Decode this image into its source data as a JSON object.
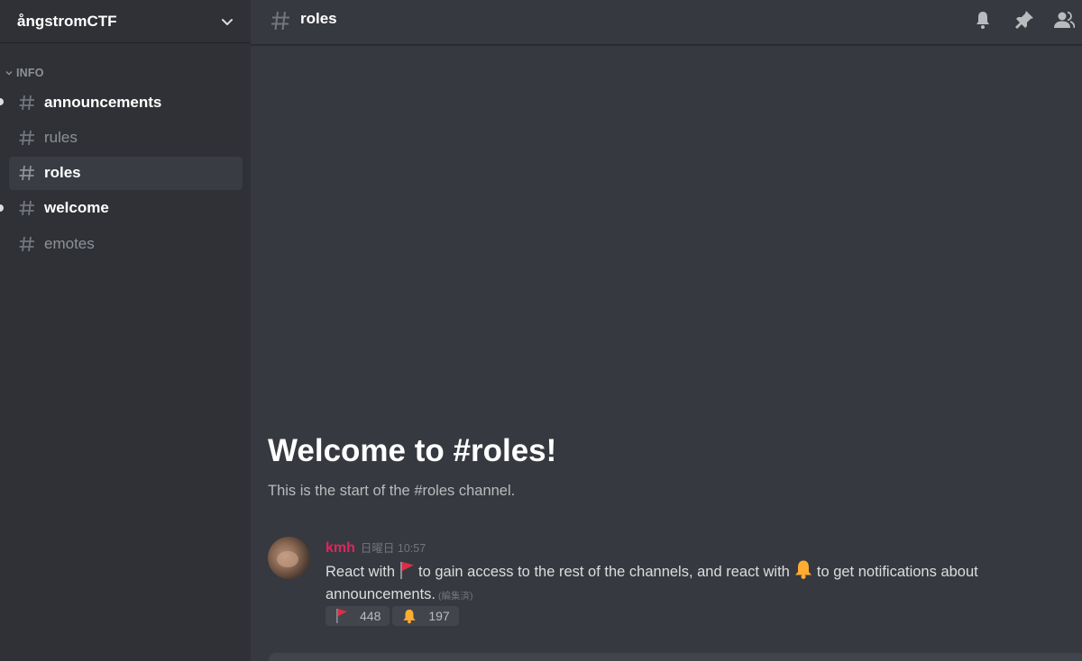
{
  "server": {
    "name": "ångstromCTF"
  },
  "sidebar": {
    "category": "INFO",
    "channels": [
      {
        "name": "announcements",
        "state": "unread"
      },
      {
        "name": "rules",
        "state": "muted"
      },
      {
        "name": "roles",
        "state": "selected"
      },
      {
        "name": "welcome",
        "state": "unread"
      },
      {
        "name": "emotes",
        "state": "muted"
      }
    ]
  },
  "topbar": {
    "channel_name": "roles",
    "icons": [
      "bell-icon",
      "pin-icon",
      "members-icon"
    ]
  },
  "main": {
    "welcome_title": "Welcome to #roles!",
    "welcome_subtitle": "This is the start of the #roles channel."
  },
  "message": {
    "author": "kmh",
    "author_color": "#e0245e",
    "timestamp": "日曜日 10:57",
    "text_part1": "React with",
    "text_part2": "to gain access to the rest of the channels, and react with",
    "text_part3": "to get notifications about announcements.",
    "edited_label": "(編集済)",
    "reactions": [
      {
        "emoji": "red-flag-icon",
        "count": "448"
      },
      {
        "emoji": "bell-emoji-icon",
        "count": "197"
      }
    ]
  },
  "colors": {
    "sidebar_bg": "#2f3136",
    "main_bg": "#36393f",
    "text_primary": "#ffffff",
    "text_muted": "#8e9297"
  }
}
